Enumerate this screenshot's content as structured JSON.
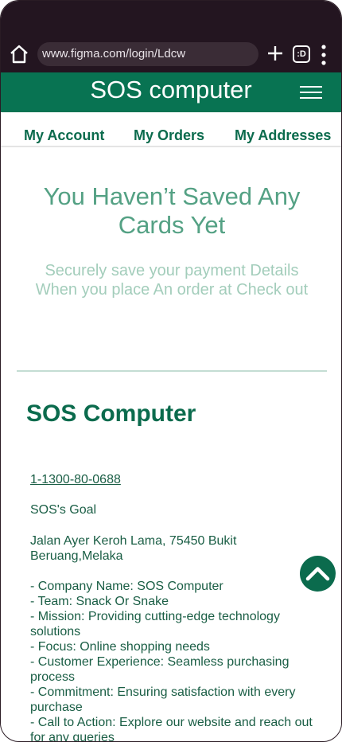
{
  "browser": {
    "url": "www.figma.com/login/Ldcw",
    "tabs_glyph": ":D"
  },
  "header": {
    "brand": "SOS computer"
  },
  "nav": {
    "items": [
      {
        "label": "My Account"
      },
      {
        "label": "My Orders"
      },
      {
        "label": "My Addresses"
      }
    ]
  },
  "empty_state": {
    "title": "You Haven’t Saved Any Cards Yet",
    "subtitle": "Securely save your payment Details When you place An order at Check out"
  },
  "footer": {
    "title": "SOS Computer",
    "phone": "1-1300-80-0688",
    "goal": "SOS's Goal",
    "address": "Jalan Ayer Keroh Lama, 75450 Bukit Beruang,Melaka",
    "facts": [
      "- Company Name: SOS Computer",
      "- Team: Snack Or Snake",
      "- Mission: Providing cutting-edge technology solutions",
      "- Focus: Online shopping needs",
      "- Customer Experience: Seamless purchasing process",
      "- Commitment: Ensuring satisfaction with every purchase",
      "- Call to Action: Explore our website and reach out for any queries"
    ]
  },
  "icons": {
    "home": "home-icon",
    "plus": "plus-icon",
    "tabs": "tab-switcher-icon",
    "menu": "kebab-menu-icon",
    "hamburger": "hamburger-menu-icon",
    "scroll_top": "chevron-up-icon"
  },
  "colors": {
    "brand_green": "#087352",
    "title_green": "#54a184",
    "subtitle_green": "#a3cdbb",
    "browser_bar": "#231520"
  }
}
